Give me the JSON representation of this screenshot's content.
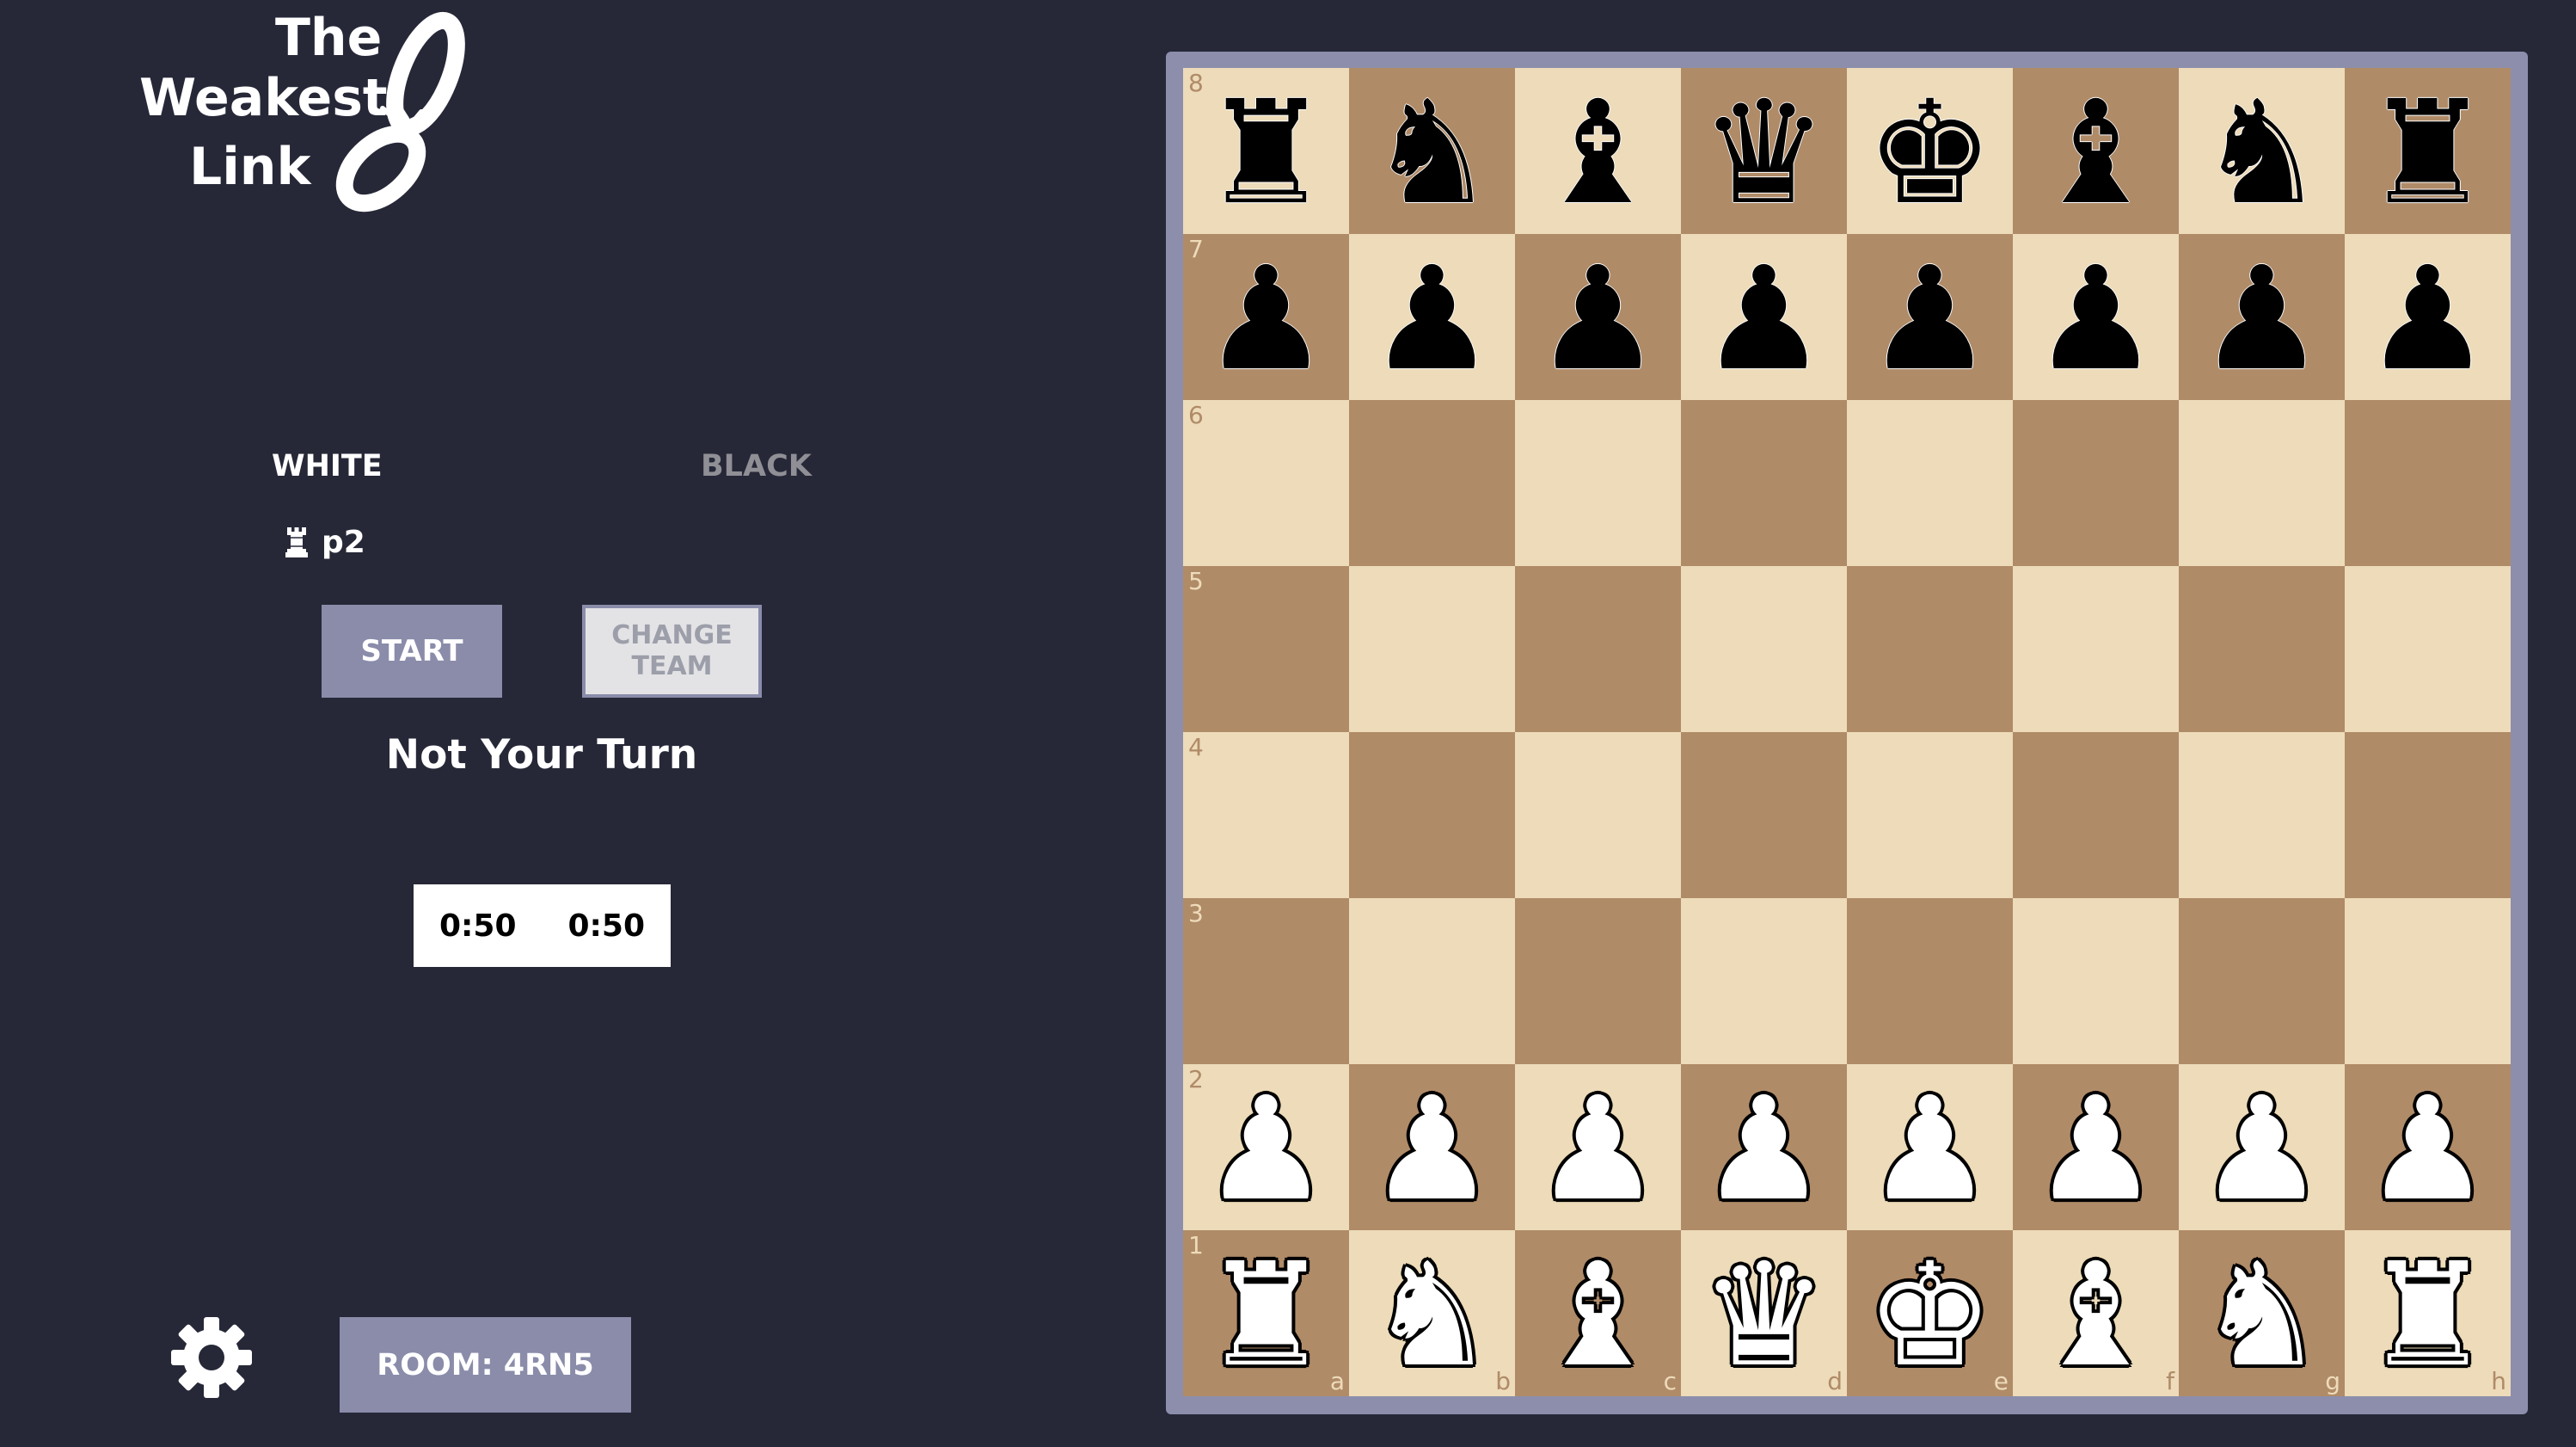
{
  "logo": {
    "line1": "The",
    "line2": "Weakest",
    "line3": "Link"
  },
  "teams": {
    "white_label": "WHITE",
    "black_label": "BLACK",
    "white_players": [
      {
        "icon": "rook-icon",
        "name": "p2"
      }
    ]
  },
  "buttons": {
    "start": "START",
    "change_team": "CHANGE TEAM",
    "room": "ROOM: 4RN5"
  },
  "status": "Not Your Turn",
  "clocks": {
    "white": "0:50",
    "black": "0:50"
  },
  "settings_icon": "gear-icon",
  "colors": {
    "background": "#262838",
    "accent": "#8a8caa",
    "light_square": "#eddbb9",
    "dark_square": "#b08b68"
  },
  "board": {
    "files": [
      "a",
      "b",
      "c",
      "d",
      "e",
      "f",
      "g",
      "h"
    ],
    "ranks": [
      "8",
      "7",
      "6",
      "5",
      "4",
      "3",
      "2",
      "1"
    ],
    "rows": [
      [
        "bR",
        "bN",
        "bB",
        "bQ",
        "bK",
        "bB",
        "bN",
        "bR"
      ],
      [
        "bP",
        "bP",
        "bP",
        "bP",
        "bP",
        "bP",
        "bP",
        "bP"
      ],
      [
        "",
        "",
        "",
        "",
        "",
        "",
        "",
        ""
      ],
      [
        "",
        "",
        "",
        "",
        "",
        "",
        "",
        ""
      ],
      [
        "",
        "",
        "",
        "",
        "",
        "",
        "",
        ""
      ],
      [
        "",
        "",
        "",
        "",
        "",
        "",
        "",
        ""
      ],
      [
        "wP",
        "wP",
        "wP",
        "wP",
        "wP",
        "wP",
        "wP",
        "wP"
      ],
      [
        "wR",
        "wN",
        "wB",
        "wQ",
        "wK",
        "wB",
        "wN",
        "wR"
      ]
    ]
  }
}
